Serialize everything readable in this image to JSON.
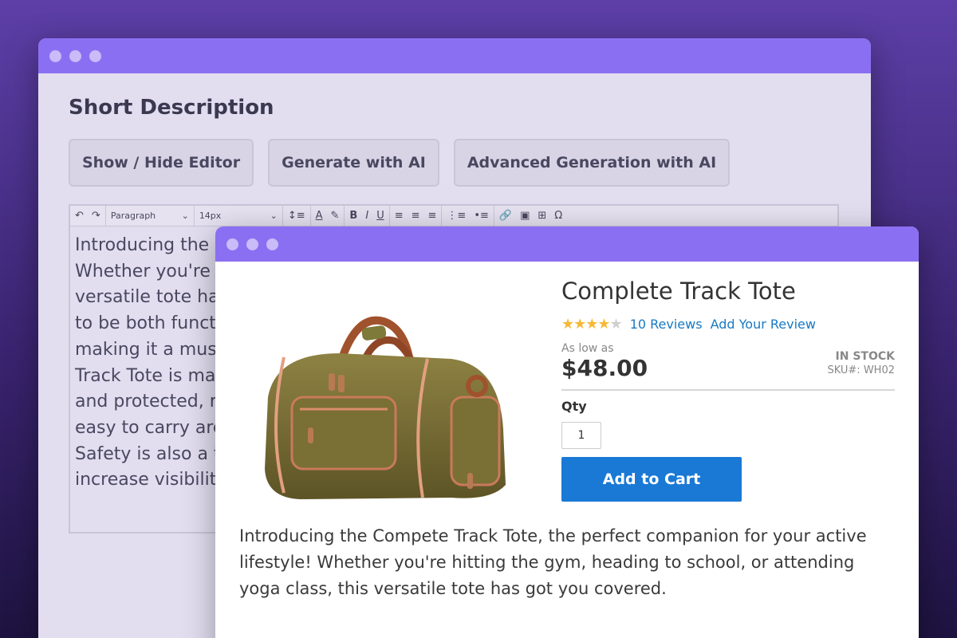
{
  "editor_window": {
    "section_title": "Short Description",
    "buttons": [
      "Show / Hide Editor",
      "Generate with AI",
      "Advanced Generation with AI"
    ],
    "toolbar": {
      "undo_icon": "↶",
      "redo_icon": "↷",
      "block_format": "Paragraph",
      "font_size": "14px",
      "chevron": "⌄",
      "line_height_icon": "↕≡",
      "text_color_icon": "A",
      "highlight_icon": "✎",
      "bold": "B",
      "italic": "I",
      "underline": "U",
      "align_left_icon": "≡",
      "align_center_icon": "≡",
      "align_right_icon": "≡",
      "numbered_list_icon": "⋮≡",
      "bullet_list_icon": "•≡",
      "link_icon": "🔗",
      "image_icon": "▣",
      "table_icon": "⊞",
      "special_char_icon": "Ω"
    },
    "content_lines": [
      "Introducing the",
      "Whether you're",
      "versatile tote ha",
      "to be both funct",
      "making it a mus",
      "Track Tote is ma",
      "and protected, r",
      "easy to carry arc",
      "Safety is also a t",
      "increase visibilit"
    ]
  },
  "product_window": {
    "title": "Complete Track Tote",
    "rating_fraction": 0.8,
    "stars": {
      "on": "★★★★",
      "off": "★"
    },
    "reviews_link": "10 Reviews",
    "add_review_link": "Add Your Review",
    "as_low_as": "As low as",
    "price": "$48.00",
    "stock": "IN STOCK",
    "sku": "SKU#: WH02",
    "qty_label": "Qty",
    "qty_value": "1",
    "add_to_cart": "Add to Cart",
    "description": "Introducing the Compete Track Tote, the perfect companion for your active lifestyle! Whether you're hitting the gym, heading to school, or attending yoga class, this versatile tote has got you covered."
  },
  "colors": {
    "title_bar": "#8b6ff2",
    "accent_blue": "#1979d5",
    "star": "#f5b933"
  }
}
